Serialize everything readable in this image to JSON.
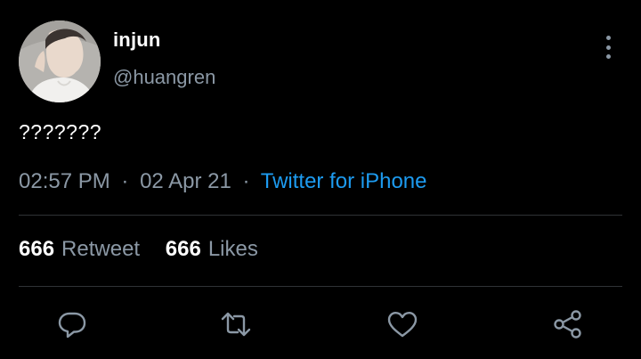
{
  "user": {
    "display_name": "injun",
    "username": "@huangren"
  },
  "tweet": {
    "text": "???????",
    "time": "02:57 PM",
    "date": "02 Apr 21",
    "separator": "·",
    "source": "Twitter for iPhone"
  },
  "stats": {
    "retweets_count": "666",
    "retweets_label": "Retweet",
    "likes_count": "666",
    "likes_label": "Likes"
  },
  "icons": {
    "more": "more-vertical-icon",
    "reply": "reply-icon",
    "retweet": "retweet-icon",
    "like": "heart-icon",
    "share": "share-icon"
  },
  "colors": {
    "background": "#000000",
    "text_primary": "#ffffff",
    "text_secondary": "#8b98a5",
    "link": "#1d9bf0",
    "divider": "#2f3336"
  }
}
